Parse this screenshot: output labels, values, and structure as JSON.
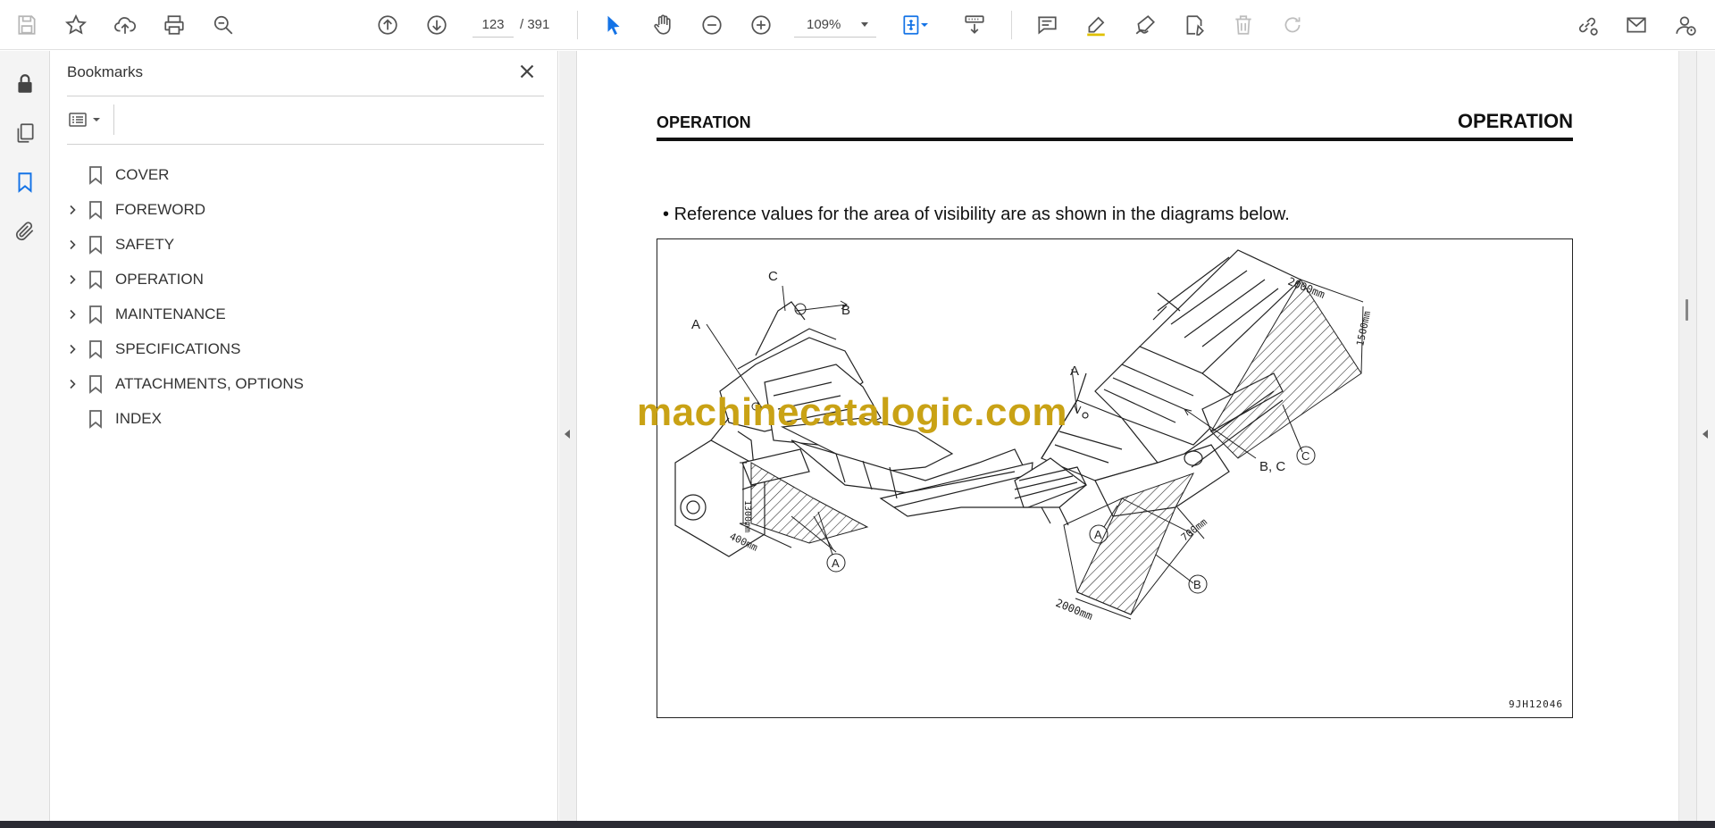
{
  "toolbar": {
    "icons": [
      "save-icon",
      "star-icon",
      "upload-cloud-icon",
      "print-icon",
      "find-zoom-icon",
      "page-up-icon",
      "page-down-icon",
      "select-cursor-icon",
      "hand-icon",
      "zoom-out-icon",
      "zoom-in-icon",
      "fit-page-icon",
      "scroll-mode-icon",
      "comment-icon",
      "highlight-pen-icon",
      "sign-icon",
      "edit-text-icon",
      "delete-icon",
      "redo-icon",
      "share-link-icon",
      "mail-icon",
      "account-icon"
    ],
    "page_current": "123",
    "page_total": "/ 391",
    "zoom": "109%",
    "accent_color": "#1473e6"
  },
  "rail": {
    "icons": [
      "lock-icon",
      "pages-icon",
      "bookmark-icon",
      "attachment-icon"
    ],
    "active": "bookmark-icon"
  },
  "bookmarks": {
    "title": "Bookmarks",
    "items": [
      {
        "label": "COVER",
        "expandable": false
      },
      {
        "label": "FOREWORD",
        "expandable": true
      },
      {
        "label": "SAFETY",
        "expandable": true
      },
      {
        "label": "OPERATION",
        "expandable": true
      },
      {
        "label": "MAINTENANCE",
        "expandable": true
      },
      {
        "label": "SPECIFICATIONS",
        "expandable": true
      },
      {
        "label": "ATTACHMENTS, OPTIONS",
        "expandable": true
      },
      {
        "label": "INDEX",
        "expandable": false
      }
    ]
  },
  "document": {
    "header_left": "OPERATION",
    "header_right": "OPERATION",
    "bullet": "•",
    "bullet_text": "Reference values for the area of visibility are as shown in the diagrams below.",
    "figure_code": "9JH12046",
    "watermark": "machinecatalogic.com",
    "figure_labels": {
      "left_a": "A",
      "left_b": "B",
      "left_c": "C",
      "left_dim_height": "1300mm",
      "left_dim_width": "400mm",
      "left_circle_a": "A",
      "right_a": "A",
      "right_bc": "B, C",
      "right_circle_a": "A",
      "right_circle_b": "B",
      "right_circle_c": "C",
      "right_dim_top": "2000mm",
      "right_dim_side": "1500mm",
      "right_dim_mid": "700mm",
      "right_dim_bottom": "2000mm"
    }
  }
}
